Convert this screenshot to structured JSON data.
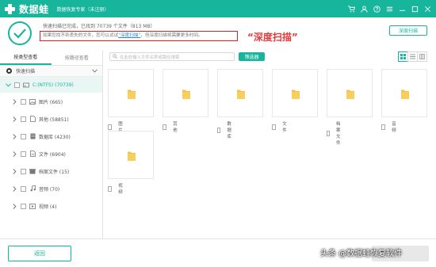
{
  "titlebar": {
    "app_name": "数据蛙",
    "edition": "数据恢复专家（未注册）"
  },
  "status": {
    "line1": "快速扫描已完成，已找到  70739  个文件（813 MB）",
    "hint_prefix": "如果您找不到丢失的文件，您可以试试",
    "hint_link": "“深度扫描”",
    "hint_suffix": "，但深度扫描将需要更多时间。",
    "callout": "“深度扫描”",
    "deep_scan_button": "深度扫描"
  },
  "sidebar": {
    "tabs": [
      "按类型查看",
      "按路径查看"
    ],
    "active_tab": 0,
    "quick_scan": "快速扫描",
    "root": "C:(NTFS) (70739)",
    "items": [
      {
        "label": "图片 (665)",
        "icon": "image-icon"
      },
      {
        "label": "其他 (58851)",
        "icon": "other-icon"
      },
      {
        "label": "数据库 (4230)",
        "icon": "database-icon"
      },
      {
        "label": "文件 (6904)",
        "icon": "document-icon"
      },
      {
        "label": "档案文件 (15)",
        "icon": "archive-icon"
      },
      {
        "label": "音频 (70)",
        "icon": "audio-icon"
      },
      {
        "label": "视频 (4)",
        "icon": "video-icon"
      }
    ]
  },
  "main": {
    "search_placeholder": "在此处输入文件名称或路径搜索",
    "filter_button": "筛选器",
    "folders": [
      "图片",
      "其他",
      "数据库",
      "文件",
      "档案文件",
      "音频",
      "视频"
    ]
  },
  "footer": {
    "back_button": "返回",
    "watermark": "头条 @数据蛙恢复软件"
  },
  "colors": {
    "accent": "#16b59c",
    "highlight_red": "#e02020",
    "folder_yellow": "#f5c342"
  }
}
